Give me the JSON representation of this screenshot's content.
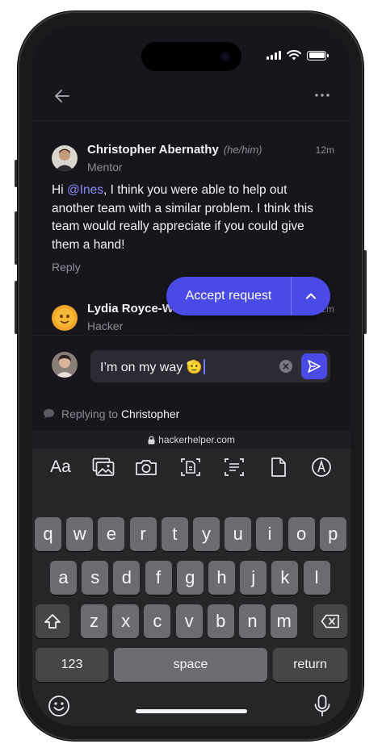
{
  "status_bar": {
    "icons": [
      "signal-icon",
      "wifi-icon",
      "battery-icon"
    ]
  },
  "header": {
    "back_icon": "arrow-left-icon",
    "more_icon": "more-horizontal-icon"
  },
  "comments": [
    {
      "author": "Christopher Abernathy",
      "pronouns": "(he/him)",
      "time": "12m",
      "role": "Mentor",
      "body_prefix": "Hi ",
      "mention": "@Ines",
      "body_suffix": ", I think you were able to help out another team with a similar problem. I think this team would really appreciate if you could give them a hand!",
      "reply_label": "Reply"
    },
    {
      "author": "Lydia Royce-Wi",
      "time": "12m",
      "role": "Hacker"
    }
  ],
  "accept": {
    "label": "Accept request",
    "icon": "chevron-up-icon"
  },
  "composer": {
    "text": "I’m on my way 🫡",
    "clear_icon": "clear-x-icon",
    "send_icon": "send-icon",
    "replying_prefix": "Replying to",
    "replying_name": "Christopher"
  },
  "url_bar": {
    "domain": "hackerhelper.com"
  },
  "keyboard": {
    "toolbar": [
      "Aa",
      "photo-library-icon",
      "camera-icon",
      "scan-text-icon",
      "document-scan-icon",
      "document-icon",
      "markup-icon"
    ],
    "row1": [
      "q",
      "w",
      "e",
      "r",
      "t",
      "y",
      "u",
      "i",
      "o",
      "p"
    ],
    "row2": [
      "a",
      "s",
      "d",
      "f",
      "g",
      "h",
      "j",
      "k",
      "l"
    ],
    "row3": [
      "z",
      "x",
      "c",
      "v",
      "b",
      "n",
      "m"
    ],
    "numbers_label": "123",
    "space_label": "space",
    "return_label": "return"
  },
  "colors": {
    "accent": "#4a4ae6",
    "mention": "#8b8bff",
    "background": "#17161c",
    "key": "#6c6c70"
  }
}
